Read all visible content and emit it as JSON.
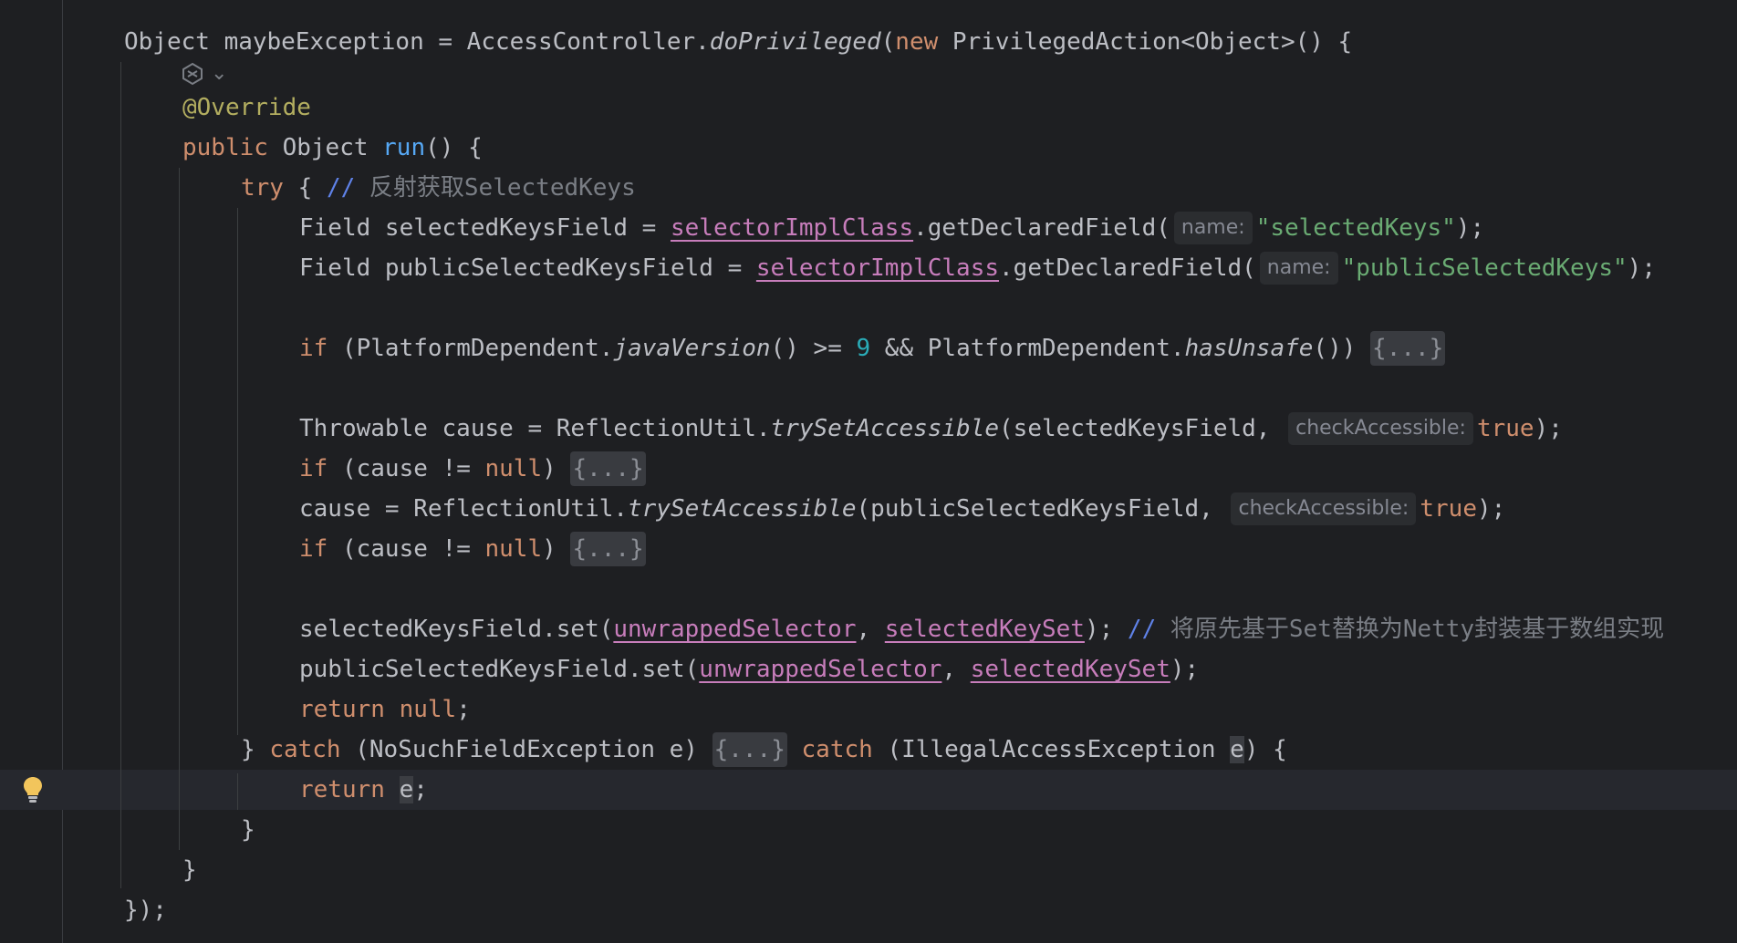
{
  "editor": {
    "language": "java",
    "colors": {
      "background": "#1e1f22",
      "current_line": "#26282e",
      "keyword": "#cf8e6d",
      "string": "#6aab73",
      "annotation": "#b3ae60",
      "field": "#c77dbb",
      "number": "#2aacb8",
      "method_decl": "#56a8f5",
      "comment": "#7a7e85"
    },
    "gutter": {
      "intention_icon": "lightbulb-icon",
      "ai_icon": "ai-assistant-icon",
      "ai_chevron": "⌄"
    },
    "code": {
      "l1_a": "Object maybeException = AccessController.",
      "l1_b": "doPrivileged",
      "l1_c": "(",
      "l1_d": "new",
      "l1_e": " PrivilegedAction<Object>() {",
      "l3": "@Override",
      "l4_a": "public",
      "l4_b": " Object ",
      "l4_c": "run",
      "l4_d": "() {",
      "l5_a": "try",
      "l5_b": " { ",
      "l5_c": "//",
      "l5_d": " 反射获取SelectedKeys",
      "l6_a": "Field selectedKeysField = ",
      "l6_b": "selectorImplClass",
      "l6_c": ".getDeclaredField(",
      "l6_hint": "name:",
      "l6_d": "\"selectedKeys\"",
      "l6_e": ");",
      "l7_a": "Field publicSelectedKeysField = ",
      "l7_b": "selectorImplClass",
      "l7_c": ".getDeclaredField(",
      "l7_hint": "name:",
      "l7_d": "\"publicSelectedKeys\"",
      "l7_e": ");",
      "l9_a": "if",
      "l9_b": " (PlatformDependent.",
      "l9_c": "javaVersion",
      "l9_d": "() >= ",
      "l9_e": "9",
      "l9_f": " && PlatformDependent.",
      "l9_g": "hasUnsafe",
      "l9_h": "()) ",
      "l9_fold": "{...}",
      "l11_a": "Throwable cause = ReflectionUtil.",
      "l11_b": "trySetAccessible",
      "l11_c": "(selectedKeysField, ",
      "l11_hint": "checkAccessible:",
      "l11_d": "true",
      "l11_e": ");",
      "l12_a": "if",
      "l12_b": " (cause != ",
      "l12_c": "null",
      "l12_d": ") ",
      "l12_fold": "{...}",
      "l13_a": "cause = ReflectionUtil.",
      "l13_b": "trySetAccessible",
      "l13_c": "(publicSelectedKeysField, ",
      "l13_hint": "checkAccessible:",
      "l13_d": "true",
      "l13_e": ");",
      "l14_a": "if",
      "l14_b": " (cause != ",
      "l14_c": "null",
      "l14_d": ") ",
      "l14_fold": "{...}",
      "l16_a": "selectedKeysField.set(",
      "l16_b": "unwrappedSelector",
      "l16_c": ", ",
      "l16_d": "selectedKeySet",
      "l16_e": "); ",
      "l16_f": "//",
      "l16_g": " 将原先基于Set替换为Netty封装基于数组实现",
      "l17_a": "publicSelectedKeysField.set(",
      "l17_b": "unwrappedSelector",
      "l17_c": ", ",
      "l17_d": "selectedKeySet",
      "l17_e": ");",
      "l18_a": "return",
      "l18_b": " ",
      "l18_c": "null",
      "l18_d": ";",
      "l19_a": "} ",
      "l19_b": "catch",
      "l19_c": " (NoSuchFieldException e) ",
      "l19_fold": "{...}",
      "l19_d": " ",
      "l19_e": "catch",
      "l19_f": " (IllegalAccessException ",
      "l19_g": "e",
      "l19_h": ") {",
      "l20_a": "return",
      "l20_b": " ",
      "l20_c": "e",
      "l20_d": ";",
      "l21": "}",
      "l22": "}",
      "l23": "});"
    }
  }
}
